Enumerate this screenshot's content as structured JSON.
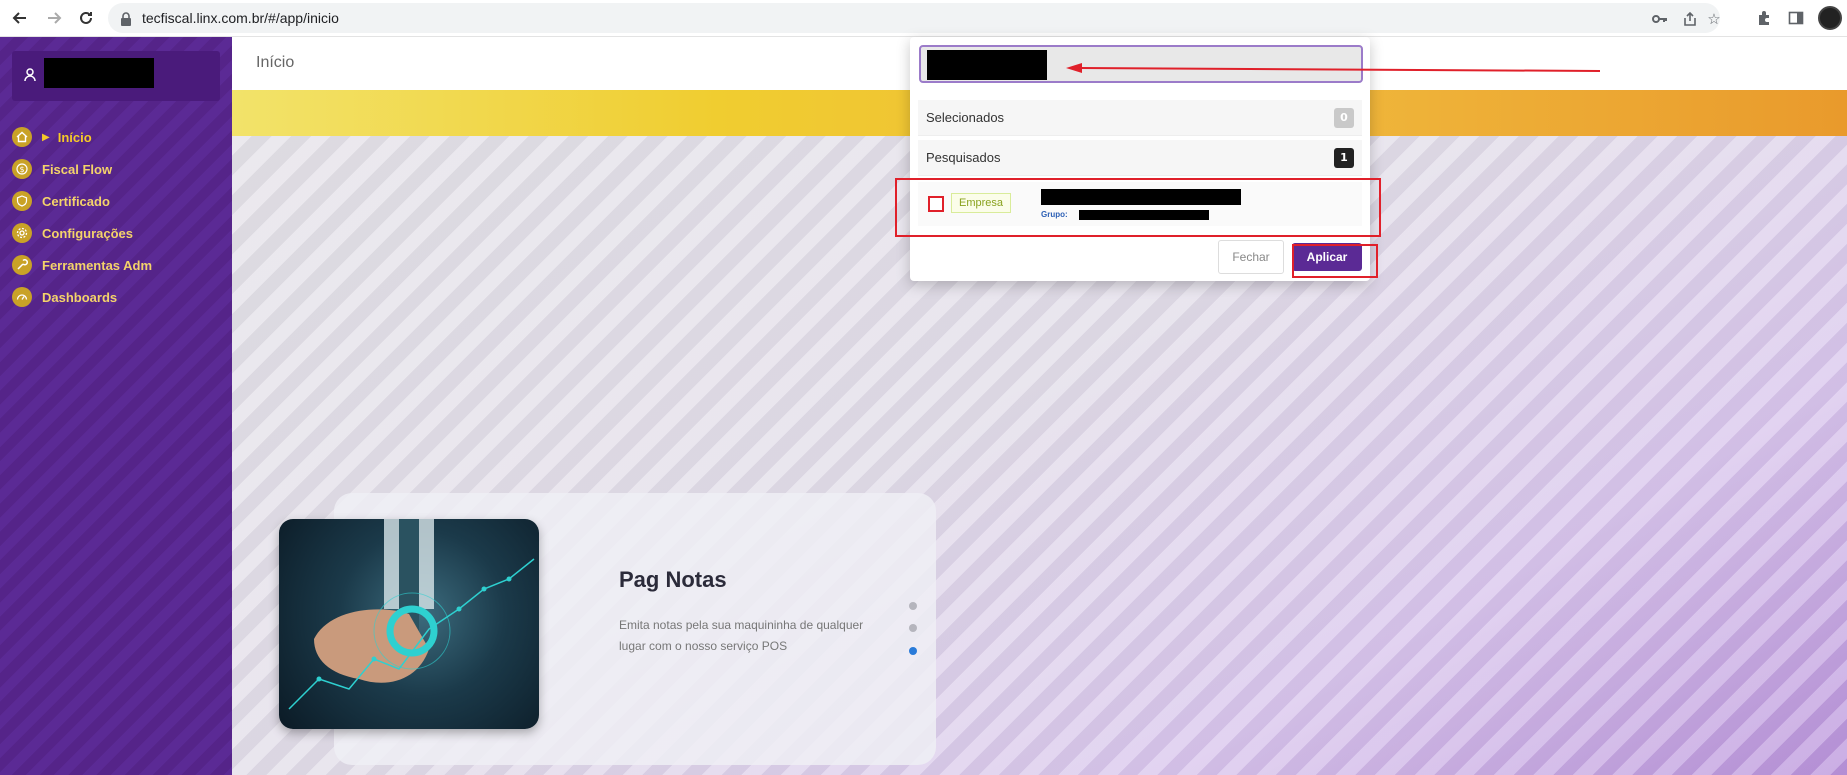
{
  "browser": {
    "url": "tecfiscal.linx.com.br/#/app/inicio",
    "icons": [
      "back-icon",
      "forward-icon",
      "reload-icon",
      "lock-icon",
      "key-icon",
      "share-icon",
      "star-icon",
      "extensions-icon",
      "sidebar-icon"
    ]
  },
  "sidebar": {
    "items": [
      {
        "label": "Início",
        "icon": "home-icon",
        "active": true
      },
      {
        "label": "Fiscal Flow",
        "icon": "dollar-icon"
      },
      {
        "label": "Certificado",
        "icon": "shield-icon"
      },
      {
        "label": "Configurações",
        "icon": "gear-icon"
      },
      {
        "label": "Ferramentas Adm",
        "icon": "wrench-icon"
      },
      {
        "label": "Dashboards",
        "icon": "gauge-icon"
      }
    ]
  },
  "header": {
    "title": "Início"
  },
  "card": {
    "title": "Pag Notas",
    "description": "Emita notas pela sua maquininha de qualquer lugar com o nosso serviço POS"
  },
  "popup": {
    "selected_label": "Selecionados",
    "selected_count": "0",
    "searched_label": "Pesquisados",
    "searched_count": "1",
    "result": {
      "tag": "Empresa",
      "grupo_label": "Grupo:"
    },
    "close_label": "Fechar",
    "apply_label": "Aplicar"
  },
  "colors": {
    "sidebar": "#5b2a95",
    "accent": "#f6c928",
    "annotation": "#e0202a"
  }
}
